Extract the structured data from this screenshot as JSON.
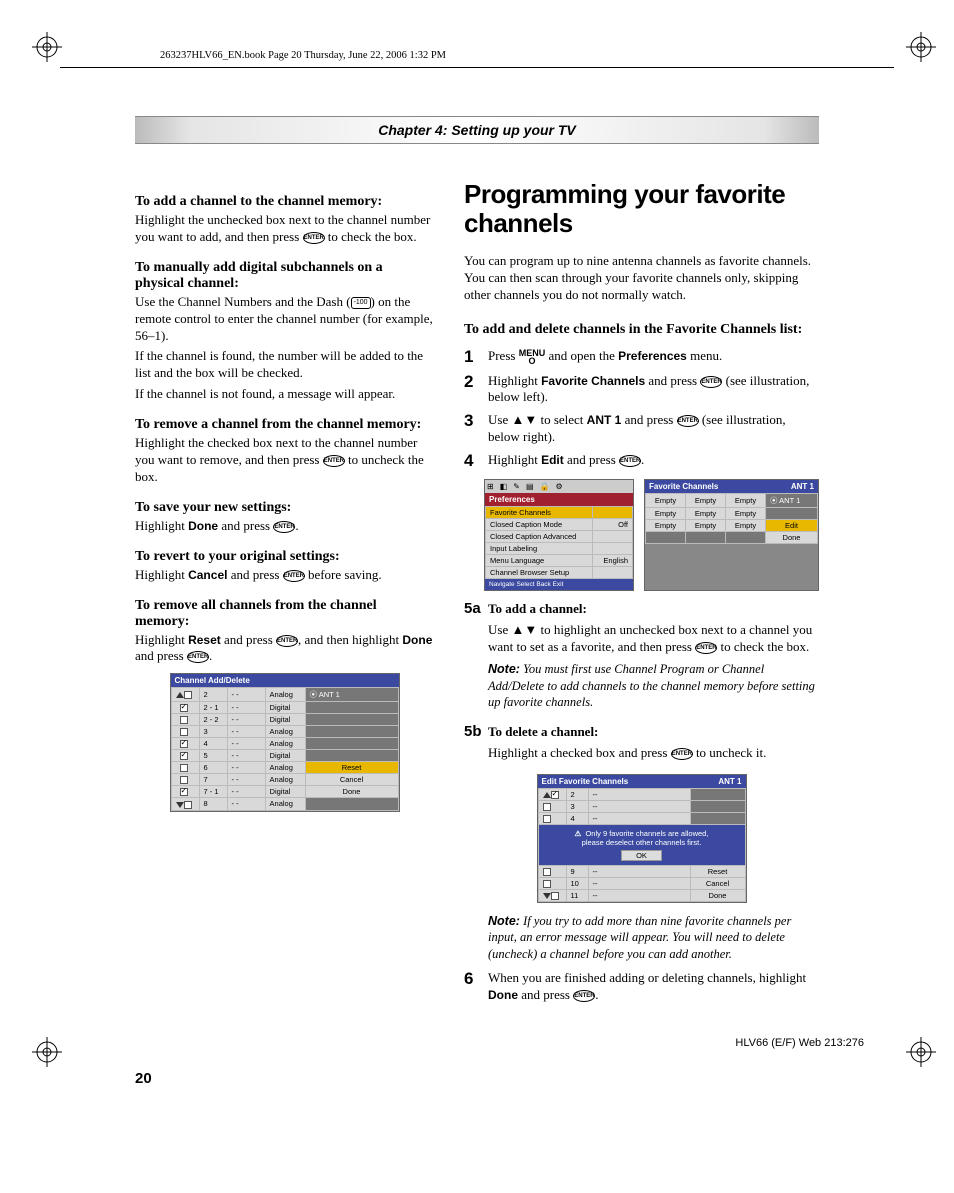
{
  "header_line": "263237HLV66_EN.book  Page 20  Thursday, June 22, 2006  1:32 PM",
  "chapter_banner": "Chapter 4: Setting up your TV",
  "left": {
    "h_add": "To add a channel to the channel memory:",
    "p_add": "Highlight the unchecked box next to the channel number you want to add, and then press ",
    "p_add2": " to check the box.",
    "h_manual": "To manually add digital subchannels on a physical channel:",
    "p_manual1a": "Use the Channel Numbers and the Dash (",
    "p_manual1b": ") on the remote control to enter the channel number (for example, 56–1).",
    "p_manual2": "If the channel is found, the number will be added to the list and the box will be checked.",
    "p_manual3": "If the channel is not found, a message will appear.",
    "h_remove": "To remove a channel from the channel memory:",
    "p_remove": "Highlight the checked box next to the channel number you want to remove, and then press ",
    "p_remove2": " to uncheck the box.",
    "h_save": "To save your new settings:",
    "p_save_a": "Highlight ",
    "p_save_b": "Done",
    "p_save_c": " and press ",
    "h_revert": "To revert to your original settings:",
    "p_revert_a": "Highlight ",
    "p_revert_b": "Cancel",
    "p_revert_c": " and press ",
    "p_revert_d": " before saving.",
    "h_removeall": "To remove all channels from the channel memory:",
    "p_removeall_a": "Highlight ",
    "p_removeall_b": "Reset",
    "p_removeall_c": " and press ",
    "p_removeall_d": ", and then highlight ",
    "p_removeall_e": "Done",
    "p_removeall_f": " and press ",
    "osd1": {
      "title": "Channel Add/Delete",
      "ant": "ANT 1",
      "rows": [
        {
          "chk": false,
          "num": "2",
          "lbl": "- -",
          "type": "Analog"
        },
        {
          "chk": true,
          "num": "2 - 1",
          "lbl": "- -",
          "type": "Digital"
        },
        {
          "chk": false,
          "num": "2 - 2",
          "lbl": "- -",
          "type": "Digital"
        },
        {
          "chk": false,
          "num": "3",
          "lbl": "- -",
          "type": "Analog"
        },
        {
          "chk": true,
          "num": "4",
          "lbl": "- -",
          "type": "Analog"
        },
        {
          "chk": true,
          "num": "5",
          "lbl": "- -",
          "type": "Digital"
        },
        {
          "chk": false,
          "num": "6",
          "lbl": "- -",
          "type": "Analog"
        },
        {
          "chk": false,
          "num": "7",
          "lbl": "- -",
          "type": "Analog"
        },
        {
          "chk": true,
          "num": "7 - 1",
          "lbl": "- -",
          "type": "Digital"
        },
        {
          "chk": false,
          "num": "8",
          "lbl": "- -",
          "type": "Analog"
        }
      ],
      "btns": [
        "Reset",
        "Cancel",
        "Done"
      ]
    }
  },
  "right": {
    "h2": "Programming your favorite channels",
    "intro": "You can program up to nine antenna channels as favorite channels. You can then scan through your favorite channels only, skipping other channels you do not normally watch.",
    "h_adddel": "To add and delete channels in the Favorite Channels list:",
    "step1a": "Press ",
    "step1b": " and open the ",
    "step1c": "Preferences",
    "step1d": " menu.",
    "step2a": "Highlight ",
    "step2b": "Favorite Channels",
    "step2c": " and press ",
    "step2d": " (see illustration, below left).",
    "step3a": "Use ",
    "step3b": " to select ",
    "step3c": "ANT 1",
    "step3d": " and press ",
    "step3e": " (see illustration, below right).",
    "step4a": "Highlight ",
    "step4b": "Edit",
    "step4c": " and press ",
    "osd_pref": {
      "title": "Preferences",
      "rows": [
        {
          "l": "Favorite Channels",
          "r": ""
        },
        {
          "l": "Closed Caption Mode",
          "r": "Off"
        },
        {
          "l": "Closed Caption Advanced",
          "r": ""
        },
        {
          "l": "Input Labeling",
          "r": ""
        },
        {
          "l": "Menu Language",
          "r": "English"
        },
        {
          "l": "Channel Browser Setup",
          "r": ""
        }
      ],
      "footer": "Navigate   Select   Back   Exit"
    },
    "osd_fav": {
      "title": "Favorite Channels",
      "ant": "ANT 1",
      "cell": "Empty",
      "btns": [
        "Edit",
        "Done"
      ]
    },
    "step5a_h": "To add a channel:",
    "step5a_p1": "Use ",
    "step5a_p2": " to highlight an unchecked box next to a channel you want to set as a favorite, and then press ",
    "step5a_p3": " to check the box.",
    "note1_l": "Note:",
    "note1": " You must first use Channel Program or Channel Add/Delete to add channels to the channel memory before setting up favorite channels.",
    "step5b_h": "To delete a channel:",
    "step5b_p1": "Highlight a checked box and press ",
    "step5b_p2": " to uncheck it.",
    "osd_edit": {
      "title": "Edit Favorite Channels",
      "ant": "ANT 1",
      "rows_top": [
        {
          "chk": true,
          "num": "2",
          "lbl": "--"
        },
        {
          "chk": false,
          "num": "3",
          "lbl": "--"
        },
        {
          "chk": false,
          "num": "4",
          "lbl": "--"
        }
      ],
      "warn1": "Only 9 favorite channels are allowed,",
      "warn2": "please deselect other channels first.",
      "ok": "OK",
      "rows_bot": [
        {
          "chk": false,
          "num": "9",
          "lbl": "--"
        },
        {
          "chk": false,
          "num": "10",
          "lbl": "--"
        },
        {
          "chk": false,
          "num": "11",
          "lbl": "--"
        }
      ],
      "btns": [
        "Reset",
        "Cancel",
        "Done"
      ]
    },
    "note2_l": "Note:",
    "note2": " If you try to add more than nine favorite channels per input, an error message will appear. You will need to delete (uncheck) a channel before you can add another.",
    "step6a": "When you are finished adding or deleting channels, highlight ",
    "step6b": "Done",
    "step6c": " and press "
  },
  "page_num": "20",
  "footer_code": "HLV66 (E/F) Web 213:276",
  "glyphs": {
    "enter": "ENTER",
    "dash": "-100",
    "menu_top": "MENU",
    "menu_bot": "O"
  }
}
